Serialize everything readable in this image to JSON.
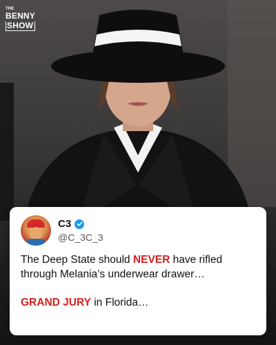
{
  "brand": {
    "small": "THE",
    "line1": "BENNY",
    "line2": "SHOW"
  },
  "post": {
    "name": "C3",
    "handle": "@C_3C_3",
    "line1_pre": "The Deep State should ",
    "line1_emphasis": "NEVER",
    "line1_post": " have rifled through Melania’s underwear drawer…",
    "line2_emphasis": "GRAND JURY",
    "line2_post": " in Florida…"
  },
  "colors": {
    "accent_red": "#d21f1f",
    "verified_blue": "#1d9bf0"
  },
  "icons": {
    "verified": "verified-badge-icon",
    "avatar": "avatar-image"
  }
}
